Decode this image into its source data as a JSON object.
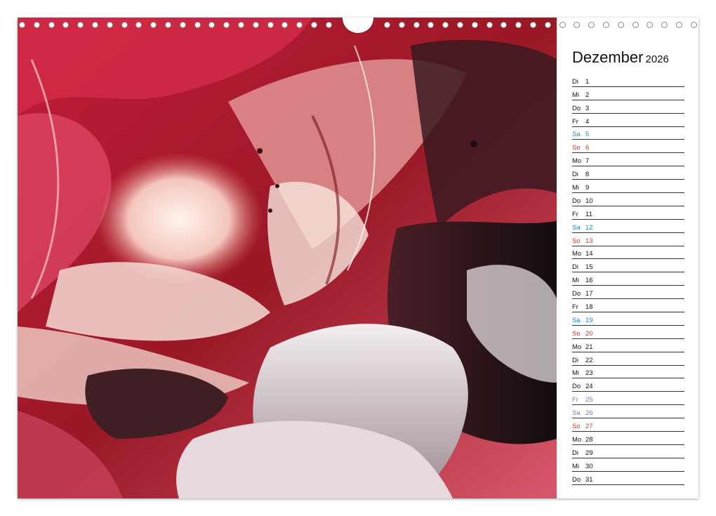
{
  "calendar": {
    "month": "Dezember",
    "year": "2026",
    "colors": {
      "saturday": "#1c86c6",
      "sunday": "#d0362e",
      "holiday": "#8b78a8"
    },
    "days": [
      {
        "wd": "Di",
        "num": "1",
        "kind": "weekday"
      },
      {
        "wd": "Mi",
        "num": "2",
        "kind": "weekday"
      },
      {
        "wd": "Do",
        "num": "3",
        "kind": "weekday"
      },
      {
        "wd": "Fr",
        "num": "4",
        "kind": "weekday"
      },
      {
        "wd": "Sa",
        "num": "5",
        "kind": "sat"
      },
      {
        "wd": "So",
        "num": "6",
        "kind": "sun"
      },
      {
        "wd": "Mo",
        "num": "7",
        "kind": "weekday"
      },
      {
        "wd": "Di",
        "num": "8",
        "kind": "weekday"
      },
      {
        "wd": "Mi",
        "num": "9",
        "kind": "weekday"
      },
      {
        "wd": "Do",
        "num": "10",
        "kind": "weekday"
      },
      {
        "wd": "Fr",
        "num": "11",
        "kind": "weekday"
      },
      {
        "wd": "Sa",
        "num": "12",
        "kind": "sat"
      },
      {
        "wd": "So",
        "num": "13",
        "kind": "sun"
      },
      {
        "wd": "Mo",
        "num": "14",
        "kind": "weekday"
      },
      {
        "wd": "Di",
        "num": "15",
        "kind": "weekday"
      },
      {
        "wd": "Mi",
        "num": "16",
        "kind": "weekday"
      },
      {
        "wd": "Do",
        "num": "17",
        "kind": "weekday"
      },
      {
        "wd": "Fr",
        "num": "18",
        "kind": "weekday"
      },
      {
        "wd": "Sa",
        "num": "19",
        "kind": "sat"
      },
      {
        "wd": "So",
        "num": "20",
        "kind": "sun"
      },
      {
        "wd": "Mo",
        "num": "21",
        "kind": "weekday"
      },
      {
        "wd": "Di",
        "num": "22",
        "kind": "weekday"
      },
      {
        "wd": "Mi",
        "num": "23",
        "kind": "weekday"
      },
      {
        "wd": "Do",
        "num": "24",
        "kind": "weekday"
      },
      {
        "wd": "Fr",
        "num": "25",
        "kind": "hol"
      },
      {
        "wd": "Sa",
        "num": "26",
        "kind": "hol"
      },
      {
        "wd": "So",
        "num": "27",
        "kind": "sun"
      },
      {
        "wd": "Mo",
        "num": "28",
        "kind": "weekday"
      },
      {
        "wd": "Di",
        "num": "29",
        "kind": "weekday"
      },
      {
        "wd": "Mi",
        "num": "30",
        "kind": "weekday"
      },
      {
        "wd": "Do",
        "num": "31",
        "kind": "weekday"
      }
    ]
  },
  "artwork": {
    "palette": [
      "#b0202e",
      "#e8a0a0",
      "#f6e2dc",
      "#6b2a32",
      "#1b1416",
      "#d7c8cc"
    ]
  }
}
